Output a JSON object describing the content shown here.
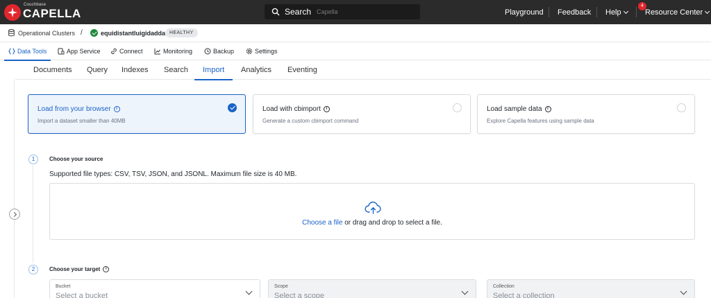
{
  "topbar": {
    "brand_small": "Couchbase",
    "brand": "CAPELLA",
    "search_label": "Search",
    "search_placeholder": "Capella",
    "nav": [
      "Playground",
      "Feedback",
      "Help"
    ],
    "resource_center": "Resource Center",
    "notification_count": "4",
    "colors": {
      "bg": "#2b2b2b",
      "accent": "#e0262e"
    }
  },
  "breadcrumb": {
    "root": "Operational Clusters",
    "separator": "/",
    "cluster": "equidistantluigidadda",
    "status": "HEALTHY"
  },
  "main_tabs": [
    {
      "label": "Data Tools",
      "icon": "braces-icon"
    },
    {
      "label": "App Service",
      "icon": "app-service-icon"
    },
    {
      "label": "Connect",
      "icon": "link-icon"
    },
    {
      "label": "Monitoring",
      "icon": "chart-icon"
    },
    {
      "label": "Backup",
      "icon": "clock-icon"
    },
    {
      "label": "Settings",
      "icon": "gear-icon"
    }
  ],
  "sub_tabs": [
    "Documents",
    "Query",
    "Indexes",
    "Search",
    "Import",
    "Analytics",
    "Eventing"
  ],
  "options": [
    {
      "title": "Load from your browser",
      "desc": "Import a dataset smaller than 40MB"
    },
    {
      "title": "Load with cbimport",
      "desc": "Generate a custom cbimport command"
    },
    {
      "title": "Load sample data",
      "desc": "Explore Capella features using sample data"
    }
  ],
  "step1": {
    "number": "1",
    "title": "Choose your source",
    "file_types": "Supported file types: CSV, TSV, JSON, and JSONL. Maximum file size is 40 MB.",
    "drop_link": "Choose a file",
    "drop_text": " or drag and drop to select a file."
  },
  "step2": {
    "number": "2",
    "title": "Choose your target",
    "selects": [
      {
        "label": "Bucket",
        "placeholder": "Select a bucket"
      },
      {
        "label": "Scope",
        "placeholder": "Select a scope"
      },
      {
        "label": "Collection",
        "placeholder": "Select a collection"
      }
    ]
  },
  "accent_color": "#1a63c7",
  "info_glyph": "i"
}
